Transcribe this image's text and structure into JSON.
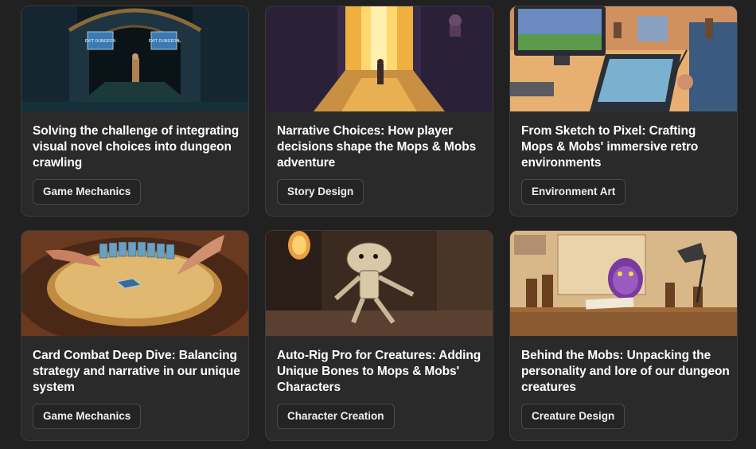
{
  "cards": [
    {
      "title": "Solving the challenge of integrating visual novel choices into dungeon crawling",
      "tag": "Game Mechanics",
      "image_sign": "EXIT DUNGEON"
    },
    {
      "title": "Narrative Choices: How player decisions shape the Mops & Mobs adventure",
      "tag": "Story Design"
    },
    {
      "title": "From Sketch to Pixel: Crafting Mops & Mobs' immersive retro environments",
      "tag": "Environment Art"
    },
    {
      "title": "Card Combat Deep Dive: Balancing strategy and narrative in our unique system",
      "tag": "Game Mechanics"
    },
    {
      "title": "Auto-Rig Pro for Creatures: Adding Unique Bones to Mops & Mobs' Characters",
      "tag": "Character Creation"
    },
    {
      "title": "Behind the Mobs: Unpacking the personality and lore of our dungeon creatures",
      "tag": "Creature Design"
    }
  ]
}
